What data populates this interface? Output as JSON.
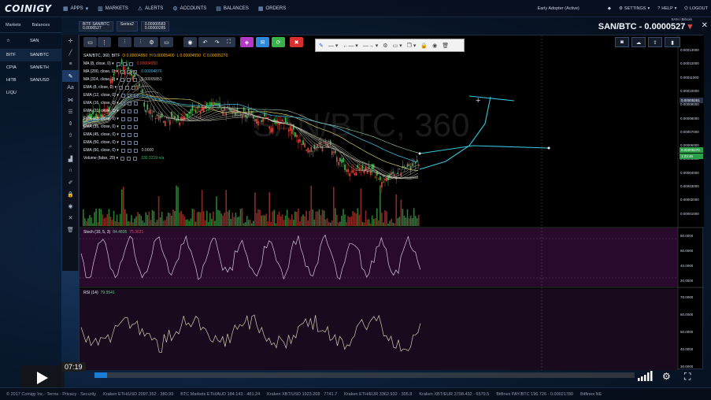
{
  "app": {
    "logo": "COINIGY"
  },
  "nav": [
    {
      "label": "APPS",
      "icon": "apps-icon"
    },
    {
      "label": "MARKETS",
      "icon": "markets-icon"
    },
    {
      "label": "ALERTS",
      "icon": "alerts-icon"
    },
    {
      "label": "ACCOUNTS",
      "icon": "accounts-icon"
    },
    {
      "label": "BALANCES",
      "icon": "balances-icon"
    },
    {
      "label": "ORDERS",
      "icon": "orders-icon"
    }
  ],
  "nav_right": {
    "status": "Early Adopter (Active)",
    "settings": "SETTINGS",
    "help": "HELP",
    "logout": "LOGOUT"
  },
  "sidebar": {
    "tabs": [
      "Markets",
      "Balances"
    ],
    "rows": [
      {
        "exchange": "☆",
        "pair": "SAN"
      },
      {
        "exchange": "BITF",
        "pair": "SAN/BTC"
      },
      {
        "exchange": "CPIA",
        "pair": "SAN/ETH"
      },
      {
        "exchange": "HITB",
        "pair": "SAN/USD"
      },
      {
        "exchange": "LIQU",
        "pair": ""
      }
    ]
  },
  "chart_tabs": [
    {
      "line1": "BITF SAN/BTC",
      "line2": "0.0000527"
    },
    {
      "line1": "Series2",
      "line2": ""
    },
    {
      "line1": "0.00000583",
      "line2": "0.00000285"
    }
  ],
  "pair_header": {
    "sub": "SAN / Bitcoin",
    "main": "SAN/BTC - 0.0000527",
    "arrow": "▾"
  },
  "chart": {
    "title": "SAN/BTC, 360, BITF",
    "ohlc": {
      "o": "O 0.00004950",
      "h": "H 0.00005400",
      "l": "L 0.00004550",
      "c": "C 0.00005270"
    },
    "indicators": [
      {
        "label": "MA (8, close, 0)",
        "value": "0.00004950",
        "color": "#e0443a"
      },
      {
        "label": "MA (200, close, 0)",
        "value": "0.00004876",
        "color": "#39b8e8"
      },
      {
        "label": "MA (314, close, 0)",
        "value": "0.00005851",
        "color": "#c9c9c9"
      },
      {
        "label": "EMA (8, close, 0)",
        "value": "",
        "color": "#c9c9c9"
      },
      {
        "label": "EMA (12, close, 0)",
        "value": "",
        "color": "#c9c9c9"
      },
      {
        "label": "EMA (16, close, 0)",
        "value": "",
        "color": "#c9c9c9"
      },
      {
        "label": "EMA (21, close, 0)",
        "value": "",
        "color": "#c9c9c9"
      },
      {
        "label": "EMA (25, close, 0)",
        "value": "",
        "color": "#c9c9c9"
      },
      {
        "label": "EMA (35, close, 0)",
        "value": "",
        "color": "#c9c9c9"
      },
      {
        "label": "EMA (45, close, 0)",
        "value": "",
        "color": "#c9c9c9"
      },
      {
        "label": "EMA (50, close, 0)",
        "value": "",
        "color": "#c9c9c9"
      },
      {
        "label": "EMA (60, close, 0)",
        "value": "0.0000",
        "color": "#c9c9c9"
      },
      {
        "label": "Volume (false, 20)",
        "value": "330.3219  n/a",
        "color": "#2cbf5a"
      }
    ],
    "watermark": "SAN/BTC, 360",
    "y_labels": [
      "0.00013000",
      "0.00012000",
      "0.00011000",
      "0.00010000",
      "0.00009000",
      "0.00008000",
      "0.00007000",
      "0.00006000",
      "0.00005000",
      "0.00004000",
      "0.00003000",
      "0.00002000",
      "0.00001000"
    ],
    "price_tags": [
      {
        "text": "0.00005251",
        "color": "#2a3348"
      },
      {
        "text": "0.00005270",
        "color": "#2aa048"
      },
      {
        "text": "1:23:46",
        "color": "#2aa048"
      }
    ],
    "stoch": {
      "label": "Stoch (10, 5, 3)",
      "v1": "84.4805",
      "v2": "75.3621",
      "ticks": [
        "80.0000",
        "60.0000",
        "40.0000",
        "20.0000"
      ]
    },
    "rsi": {
      "label": "RSI (14)",
      "value": "79.9541",
      "ticks": [
        "70.0000",
        "60.0000",
        "50.0000",
        "40.0000",
        "30.0000"
      ]
    }
  },
  "player": {
    "time": "07:19",
    "progress": 0.024
  },
  "footer": {
    "copyright": "© 2017 Coinigy Inc.· Terms · Privacy · Security",
    "tickers": [
      "Kraken ETH/USD 2097.352 · 380.99",
      "BTC Markets ETH/AUD 184.143 · 481.24",
      "Kraken XBT/USD 1923.208 · 7741.7",
      "Kraken ETH/EUR 3362.932 · 305.8",
      "Kraken XBT/EUR 3798.432 · 6579.5",
      "Bitfinex PAY/BTC 196.726 · 0.00021780",
      "Bitfinex NE"
    ]
  }
}
